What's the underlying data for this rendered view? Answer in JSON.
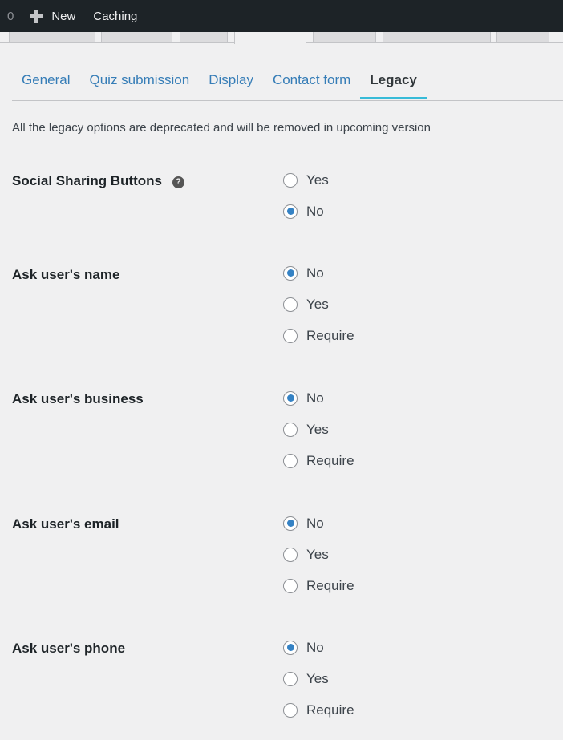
{
  "adminbar": {
    "count": "0",
    "new_label": "New",
    "caching_label": "Caching"
  },
  "subtabs": [
    {
      "label": "General",
      "active": false
    },
    {
      "label": "Quiz submission",
      "active": false
    },
    {
      "label": "Display",
      "active": false
    },
    {
      "label": "Contact form",
      "active": false
    },
    {
      "label": "Legacy",
      "active": true
    }
  ],
  "notice": "All the legacy options are deprecated and will be removed in upcoming version",
  "settings": [
    {
      "label": "Social Sharing Buttons",
      "help": "?",
      "options": [
        "Yes",
        "No"
      ],
      "selected": "No"
    },
    {
      "label": "Ask user's name",
      "options": [
        "No",
        "Yes",
        "Require"
      ],
      "selected": "No"
    },
    {
      "label": "Ask user's business",
      "options": [
        "No",
        "Yes",
        "Require"
      ],
      "selected": "No"
    },
    {
      "label": "Ask user's email",
      "options": [
        "No",
        "Yes",
        "Require"
      ],
      "selected": "No"
    },
    {
      "label": "Ask user's phone",
      "options": [
        "No",
        "Yes",
        "Require"
      ],
      "selected": "No"
    }
  ],
  "colors": {
    "accent": "#24b6d6",
    "link": "#2271b1",
    "radio_checked": "#3582c4",
    "adminbar_bg": "#1d2327"
  }
}
